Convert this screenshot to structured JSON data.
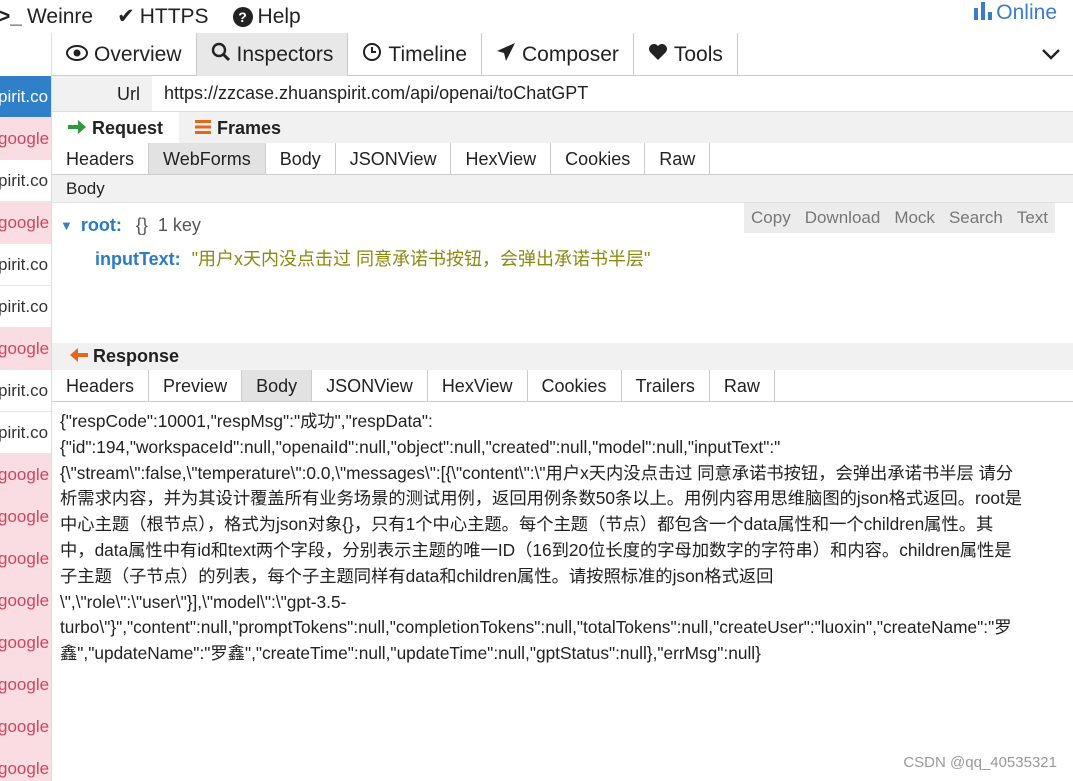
{
  "topbar": {
    "weinre": "Weinre",
    "https": "HTTPS",
    "help": "Help",
    "online": "Online"
  },
  "sidebar": {
    "items": [
      {
        "label": "pirit.co",
        "kind": "active"
      },
      {
        "label": "google",
        "kind": "google"
      },
      {
        "label": "pirit.co",
        "kind": "normal"
      },
      {
        "label": "google",
        "kind": "google"
      },
      {
        "label": "pirit.co",
        "kind": "normal"
      },
      {
        "label": "pirit.co",
        "kind": "normal"
      },
      {
        "label": "google",
        "kind": "google"
      },
      {
        "label": "pirit.co",
        "kind": "normal"
      },
      {
        "label": "pirit.co",
        "kind": "normal"
      },
      {
        "label": "google",
        "kind": "google"
      },
      {
        "label": "google",
        "kind": "google"
      },
      {
        "label": "google",
        "kind": "google"
      },
      {
        "label": "google",
        "kind": "google"
      },
      {
        "label": "google",
        "kind": "google"
      },
      {
        "label": "google",
        "kind": "google"
      },
      {
        "label": "google",
        "kind": "google"
      },
      {
        "label": "google",
        "kind": "google"
      }
    ]
  },
  "main_tabs": {
    "overview": "Overview",
    "inspectors": "Inspectors",
    "timeline": "Timeline",
    "composer": "Composer",
    "tools": "Tools"
  },
  "url": {
    "label": "Url",
    "value": "https://zzcase.zhuanspirit.com/api/openai/toChatGPT"
  },
  "request": {
    "tab_request": "Request",
    "tab_frames": "Frames",
    "subtabs": [
      "Headers",
      "WebForms",
      "Body",
      "JSONView",
      "HexView",
      "Cookies",
      "Raw"
    ],
    "active_subtab": "WebForms",
    "body_label": "Body",
    "tree": {
      "root_key": "root:",
      "root_braces": "{}",
      "root_count": "1 key",
      "child_key": "inputText:",
      "child_value": "\"用户x天内没点击过 同意承诺书按钮，会弹出承诺书半层\""
    },
    "toolbar": [
      "Copy",
      "Download",
      "Mock",
      "Search",
      "Text"
    ]
  },
  "response": {
    "title": "Response",
    "subtabs": [
      "Headers",
      "Preview",
      "Body",
      "JSONView",
      "HexView",
      "Cookies",
      "Trailers",
      "Raw"
    ],
    "active_subtab": "Body",
    "lines": [
      "{\"respCode\":10001,\"respMsg\":\"成功\",\"respData\":",
      "{\"id\":194,\"workspaceId\":null,\"openaiId\":null,\"object\":null,\"created\":null,\"model\":null,\"inputText\":\"",
      "{\\\"stream\\\":false,\\\"temperature\\\":0.0,\\\"messages\\\":[{\\\"content\\\":\\\"用户x天内没点击过 同意承诺书按钮，会弹出承诺书半层 请分",
      "析需求内容，并为其设计覆盖所有业务场景的测试用例，返回用例条数50条以上。用例内容用思维脑图的json格式返回。root是",
      "中心主题（根节点），格式为json对象{}，只有1个中心主题。每个主题（节点）都包含一个data属性和一个children属性。其",
      "中，data属性中有id和text两个字段，分别表示主题的唯一ID（16到20位长度的字母加数字的字符串）和内容。children属性是",
      "子主题（子节点）的列表，每个子主题同样有data和children属性。请按照标准的json格式返回",
      "\\\",\\\"role\\\":\\\"user\\\"}],\\\"model\\\":\\\"gpt-3.5-",
      "turbo\\\"}\",\"content\":null,\"promptTokens\":null,\"completionTokens\":null,\"totalTokens\":null,\"createUser\":\"luoxin\",\"createName\":\"罗",
      "鑫\",\"updateName\":\"罗鑫\",\"createTime\":null,\"updateTime\":null,\"gptStatus\":null},\"errMsg\":null}"
    ]
  },
  "watermark": "CSDN @qq_40535321",
  "colors": {
    "accent_blue": "#2f80c8",
    "google_bg": "#f9dde2",
    "google_text": "#d0455e",
    "request_arrow": "#2e9a3a",
    "frames_icon": "#e2691c",
    "response_arrow": "#e2691c"
  }
}
